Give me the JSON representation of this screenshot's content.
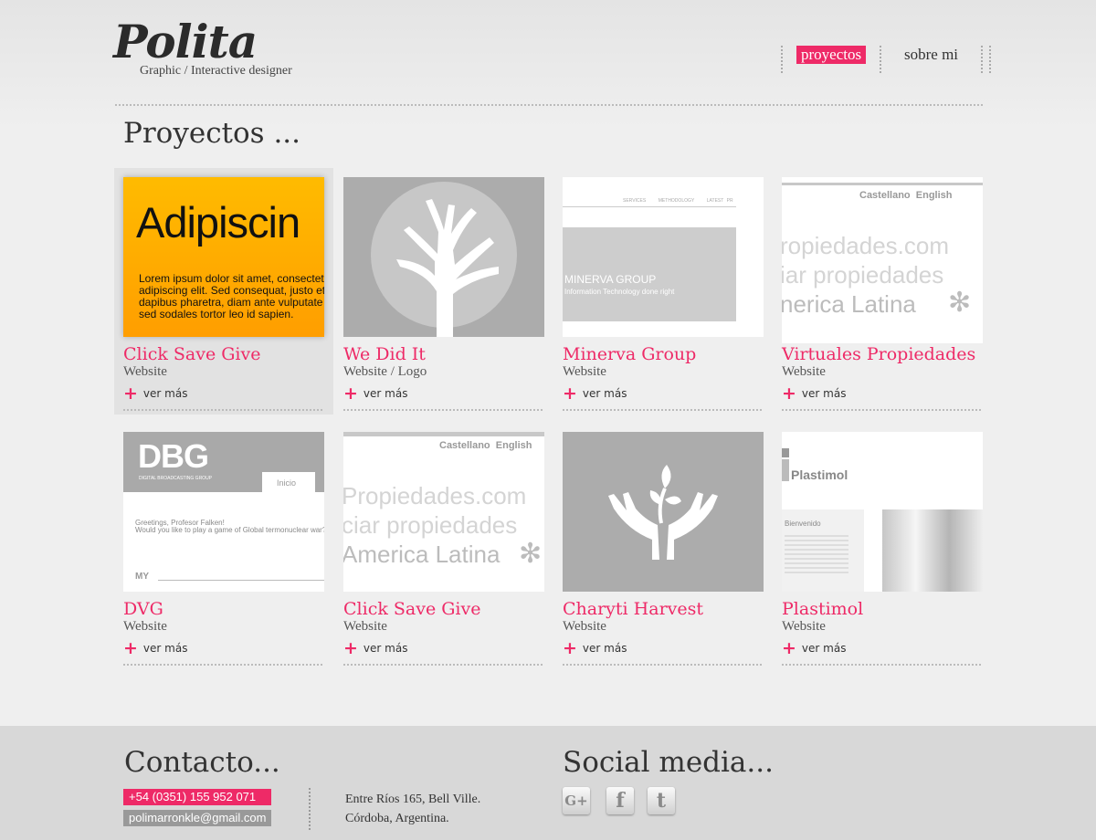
{
  "header": {
    "logo": "Polita",
    "tagline": "Graphic / Interactive designer",
    "nav": [
      {
        "label": "proyectos",
        "active": true
      },
      {
        "label": "sobre mi",
        "active": false
      }
    ]
  },
  "section_title": "Proyectos ...",
  "projects": [
    {
      "title": "Click Save Give",
      "type": "Website",
      "more": "ver más",
      "thumb": {
        "headline": "Adipiscin",
        "body": [
          "Lorem ipsum dolor sit amet, consectet",
          "adipiscing elit. Sed consequat, justo et",
          "dapibus pharetra, diam ante vulputate",
          "sed sodales tortor leo id sapien."
        ]
      }
    },
    {
      "title": "We Did It",
      "type": "Website / Logo",
      "more": "ver más"
    },
    {
      "title": "Minerva Group",
      "type": "Website",
      "more": "ver más",
      "thumb": {
        "menu": [
          "SERVICES",
          "METHODOLOGY",
          "LATEST PR"
        ],
        "name": "MINERVA GROUP",
        "slogan": "Information Technology done right"
      }
    },
    {
      "title": "Virtuales Propiedades",
      "type": "Website",
      "more": "ver más",
      "thumb": {
        "lang": [
          "Castellano",
          "English"
        ],
        "lines": [
          "ropiedades.com",
          "iar propiedades",
          "nerica Latina"
        ]
      }
    },
    {
      "title": "DVG",
      "type": "Website",
      "more": "ver más",
      "thumb": {
        "logo": "DBG",
        "logo_sub": "DIGITAL BROADCASTING GROUP",
        "tab": "Inicio",
        "greeting": "Greetings, Profesor Falken!",
        "question": "Would you like to play a game of Global termonuclear war?",
        "footer": "MY"
      }
    },
    {
      "title": "Click Save Give",
      "type": "Website",
      "more": "ver más",
      "thumb": {
        "lang": [
          "Castellano",
          "English"
        ],
        "lines": [
          "Propiedades.com",
          "ciar propiedades",
          "America Latina"
        ]
      }
    },
    {
      "title": "Charyti Harvest",
      "type": "Website",
      "more": "ver más"
    },
    {
      "title": "Plastimol",
      "type": "Website",
      "more": "ver más",
      "thumb": {
        "logo": "Plastimol",
        "welcome": "Bienvenido"
      }
    }
  ],
  "footer": {
    "contact_title": "Contacto...",
    "phone": "+54 (0351) 155 952 071",
    "email": "polimarronkle@gmail.com",
    "address": [
      "Entre Ríos 165, Bell Ville.",
      "Córdoba, Argentina."
    ],
    "social_title": "Social media...",
    "social": [
      {
        "icon": "google-plus-icon",
        "glyph": "G+"
      },
      {
        "icon": "facebook-icon",
        "glyph": "f"
      },
      {
        "icon": "twitter-icon",
        "glyph": "t"
      }
    ]
  },
  "colors": {
    "accent": "#ee2a67",
    "background": "#efefef",
    "footer": "#d8d8d8"
  }
}
